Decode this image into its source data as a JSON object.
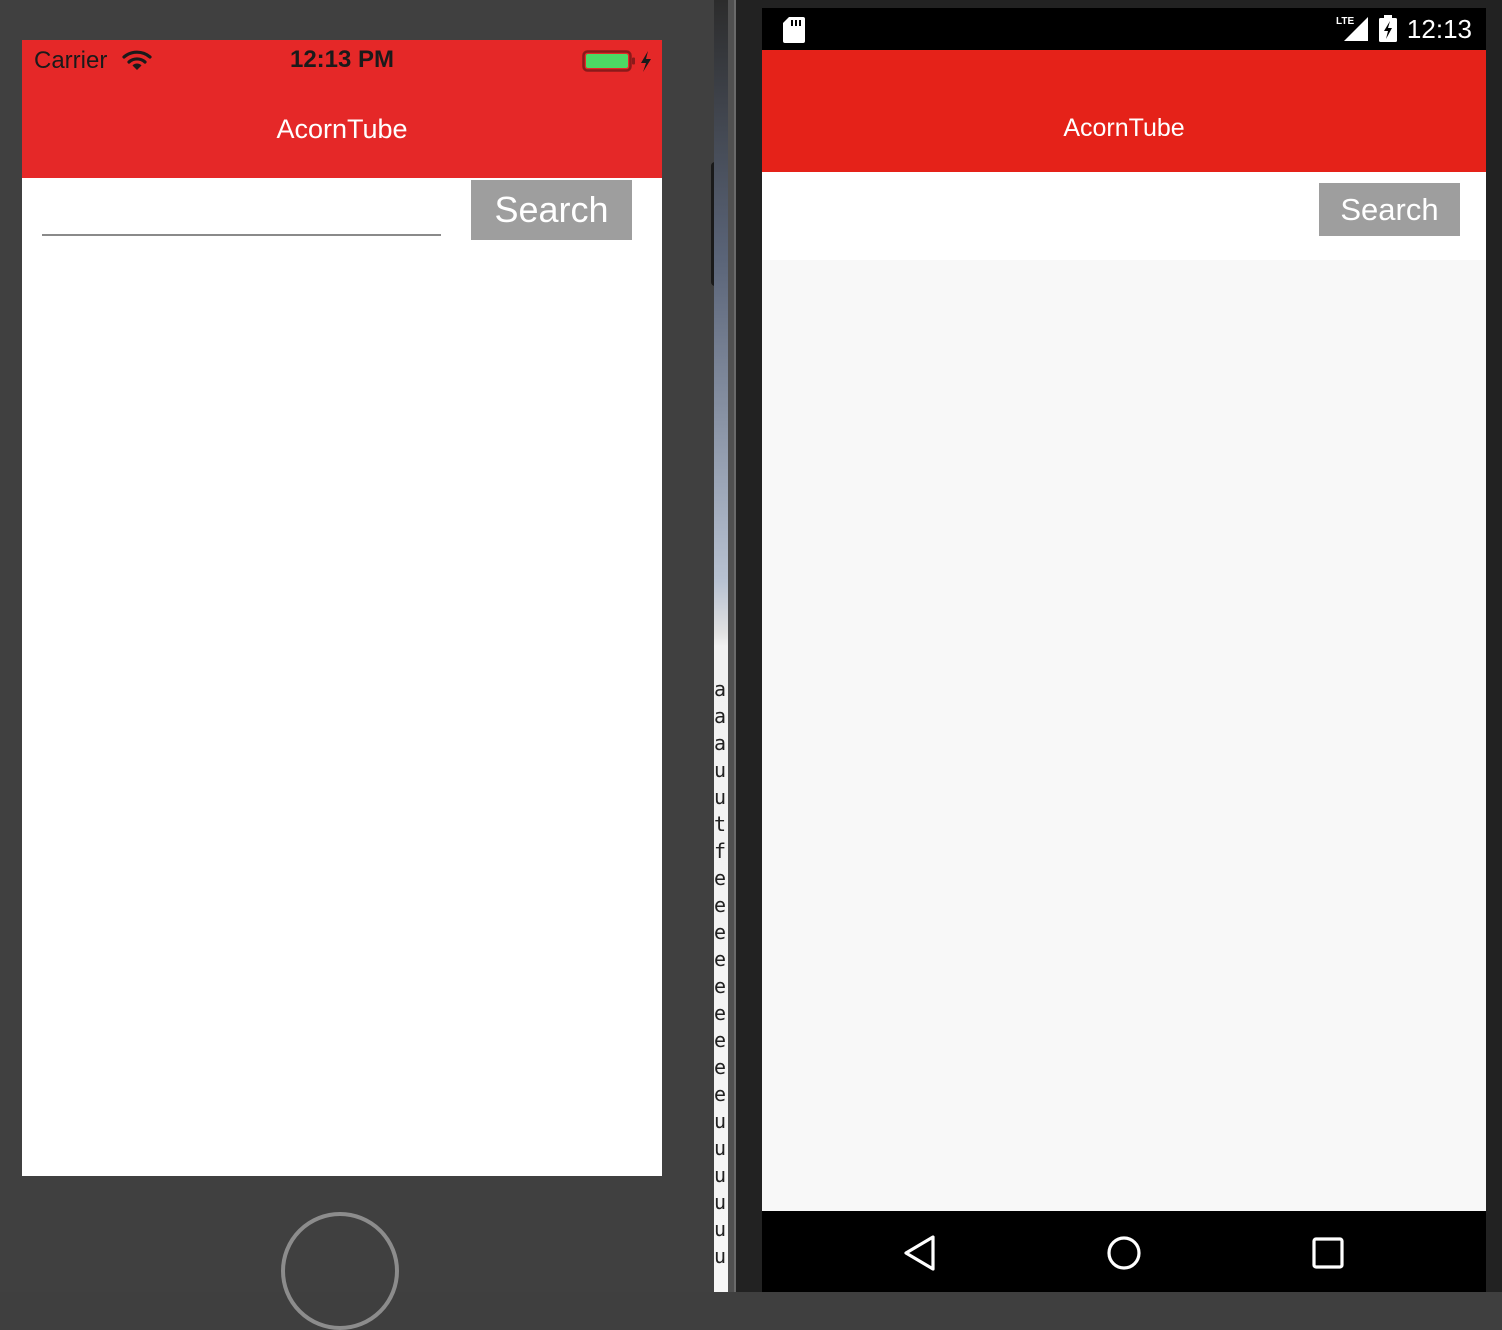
{
  "ios": {
    "status_bar": {
      "carrier": "Carrier",
      "time": "12:13 PM"
    },
    "nav_bar": {
      "title": "AcornTube",
      "color": "#e52828"
    },
    "search": {
      "input_value": "",
      "button_label": "Search"
    }
  },
  "underlying_window": {
    "chars": [
      "a",
      "a",
      "a",
      "u",
      "u",
      "t",
      "f",
      "e",
      "e",
      "e",
      "e",
      "e",
      "e",
      "e",
      "e",
      "e",
      "u",
      "u",
      "u",
      "u",
      "u",
      "u"
    ]
  },
  "android": {
    "status_bar": {
      "time": "12:13",
      "network": "LTE"
    },
    "toolbar": {
      "title": "AcornTube",
      "color": "#e52219"
    },
    "search": {
      "input_value": "",
      "button_label": "Search"
    },
    "nav_bar": {
      "buttons": [
        "back-icon",
        "home-icon",
        "recents-icon"
      ]
    }
  },
  "colors": {
    "button_gray": "#9e9e9e",
    "content_background": "#f8f8f8"
  }
}
